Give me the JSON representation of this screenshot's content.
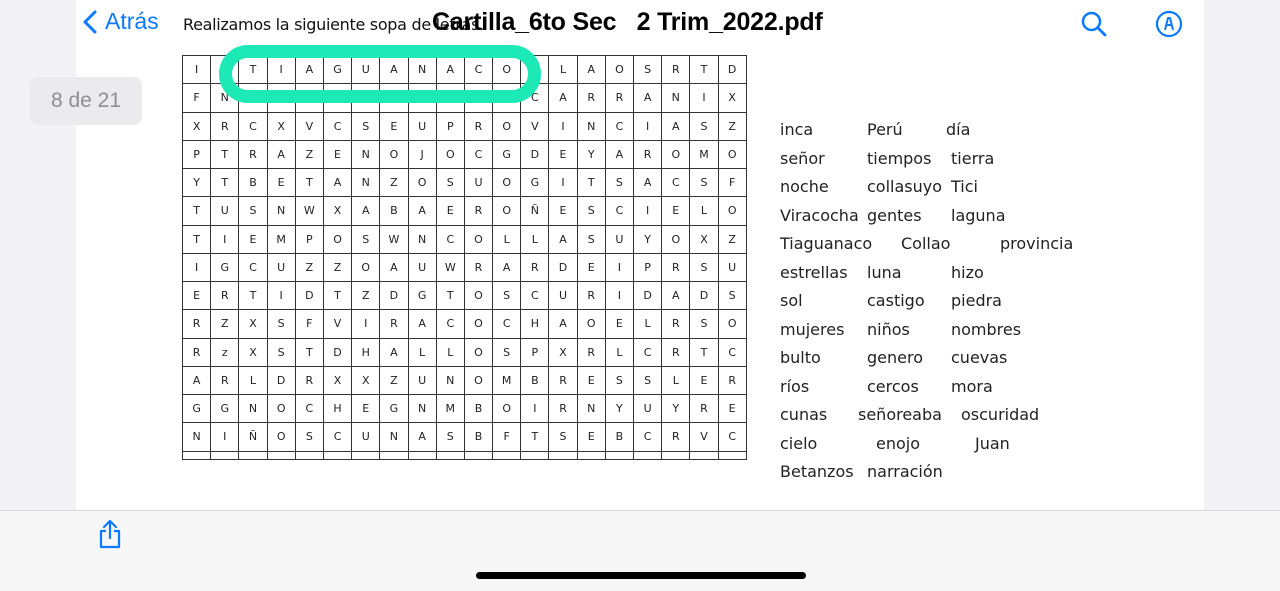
{
  "header": {
    "back_label": "Atrás",
    "document_title": "Cartilla_6to Sec   2 Trim_2022.pdf",
    "page_heading": "Realizamos la siguiente sopa de letras."
  },
  "page_indicator": "8 de 21",
  "colors": {
    "accent": "#0a7aff",
    "highlight": "#1de9b6"
  },
  "icons": {
    "back": "chevron-left-icon",
    "search": "search-icon",
    "markup": "markup-pen-icon",
    "share": "share-icon"
  },
  "grid": {
    "rows": [
      [
        "I",
        "",
        "T",
        "I",
        "A",
        "G",
        "U",
        "A",
        "N",
        "A",
        "C",
        "O",
        "",
        "L",
        "A",
        "O",
        "S",
        "R",
        "T",
        "D"
      ],
      [
        "F",
        "N",
        "",
        "",
        "",
        "",
        "",
        "",
        "",
        "",
        "",
        "",
        "C",
        "A",
        "R",
        "R",
        "A",
        "N",
        "I",
        "X"
      ],
      [
        "X",
        "R",
        "C",
        "X",
        "V",
        "C",
        "S",
        "E",
        "U",
        "P",
        "R",
        "O",
        "V",
        "I",
        "N",
        "C",
        "I",
        "A",
        "S",
        "Z"
      ],
      [
        "P",
        "T",
        "R",
        "A",
        "Z",
        "E",
        "N",
        "O",
        "J",
        "O",
        "C",
        "G",
        "D",
        "E",
        "Y",
        "A",
        "R",
        "O",
        "M",
        "O"
      ],
      [
        "Y",
        "T",
        "B",
        "E",
        "T",
        "A",
        "N",
        "Z",
        "O",
        "S",
        "U",
        "O",
        "G",
        "I",
        "T",
        "S",
        "A",
        "C",
        "S",
        "F"
      ],
      [
        "T",
        "U",
        "S",
        "N",
        "W",
        "X",
        "A",
        "B",
        "A",
        "E",
        "R",
        "O",
        "Ñ",
        "E",
        "S",
        "C",
        "I",
        "E",
        "L",
        "O"
      ],
      [
        "T",
        "I",
        "E",
        "M",
        "P",
        "O",
        "S",
        "W",
        "N",
        "C",
        "O",
        "L",
        "L",
        "A",
        "S",
        "U",
        "Y",
        "O",
        "X",
        "Z"
      ],
      [
        "I",
        "G",
        "C",
        "U",
        "Z",
        "Z",
        "O",
        "A",
        "U",
        "W",
        "R",
        "A",
        "R",
        "D",
        "E",
        "I",
        "P",
        "R",
        "S",
        "U"
      ],
      [
        "E",
        "R",
        "T",
        "I",
        "D",
        "T",
        "Z",
        "D",
        "G",
        "T",
        "O",
        "S",
        "C",
        "U",
        "R",
        "I",
        "D",
        "A",
        "D",
        "S"
      ],
      [
        "R",
        "Z",
        "X",
        "S",
        "F",
        "V",
        "I",
        "R",
        "A",
        "C",
        "O",
        "C",
        "H",
        "A",
        "O",
        "E",
        "L",
        "R",
        "S",
        "O"
      ],
      [
        "R",
        "z",
        "X",
        "S",
        "T",
        "D",
        "H",
        "A",
        "L",
        "L",
        "O",
        "S",
        "P",
        "X",
        "R",
        "L",
        "C",
        "R",
        "T",
        "C"
      ],
      [
        "A",
        "R",
        "L",
        "D",
        "R",
        "X",
        "X",
        "Z",
        "U",
        "N",
        "O",
        "M",
        "B",
        "R",
        "E",
        "S",
        "S",
        "L",
        "E",
        "R"
      ],
      [
        "G",
        "G",
        "N",
        "O",
        "C",
        "H",
        "E",
        "G",
        "N",
        "M",
        "B",
        "O",
        "I",
        "R",
        "N",
        "Y",
        "U",
        "Y",
        "R",
        "E"
      ],
      [
        "N",
        "I",
        "Ñ",
        "O",
        "S",
        "C",
        "U",
        "N",
        "A",
        "S",
        "B",
        "F",
        "T",
        "S",
        "E",
        "B",
        "C",
        "R",
        "V",
        "C"
      ],
      [
        "",
        "",
        "",
        "",
        "",
        "",
        "",
        "",
        "",
        "",
        "",
        "",
        "",
        "",
        "",
        "",
        "",
        "",
        "",
        ""
      ]
    ]
  },
  "word_list": [
    [
      "inca",
      "Perú",
      "día"
    ],
    [
      "señor",
      "tiempos",
      "tierra"
    ],
    [
      "noche",
      "collasuyo",
      "Tici"
    ],
    [
      "Viracocha",
      "gentes",
      "laguna"
    ],
    [
      "Tiaguanaco",
      "Collao",
      "provincia"
    ],
    [
      "estrellas",
      "luna",
      "hizo"
    ],
    [
      "sol",
      "castigo",
      "piedra"
    ],
    [
      "mujeres",
      "niños",
      "nombres"
    ],
    [
      "bulto",
      "genero",
      "cuevas"
    ],
    [
      "ríos",
      "cercos",
      "mora"
    ],
    [
      "cunas",
      "señoreaba",
      "oscuridad"
    ],
    [
      "cielo",
      "enojo",
      "Juan"
    ],
    [
      "Betanzos",
      "narración"
    ]
  ]
}
